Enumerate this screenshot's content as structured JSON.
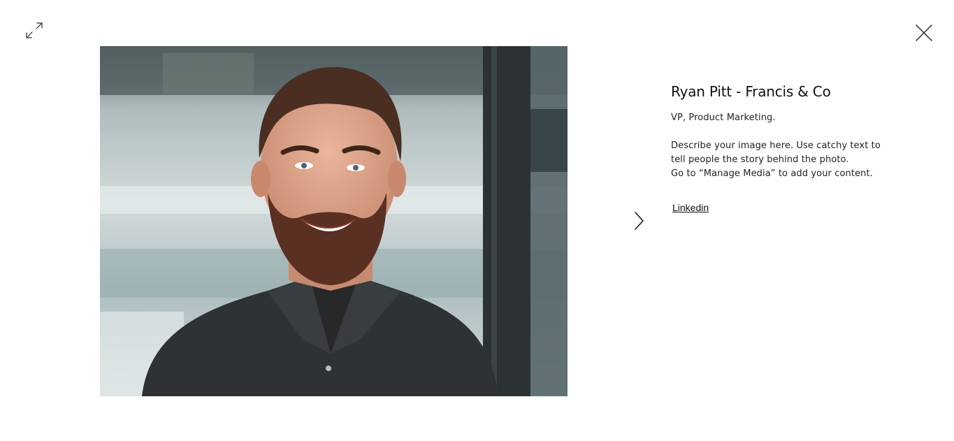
{
  "toolbar": {
    "expand_icon": "expand-arrows-icon",
    "close_icon": "close-x-icon"
  },
  "navigation": {
    "next_icon": "chevron-right-icon"
  },
  "item": {
    "title": "Ryan Pitt - Francis & Co",
    "subtitle": "VP, Product Marketing.",
    "description": [
      "Describe your image here. Use catchy text to",
      "tell people the story behind the photo.",
      "Go to “Manage Media” to add your content."
    ],
    "link_label": "Linkedin"
  },
  "colors": {
    "background": "#ffffff",
    "text": "#1a1a1a",
    "icon": "#2b2b2b"
  }
}
